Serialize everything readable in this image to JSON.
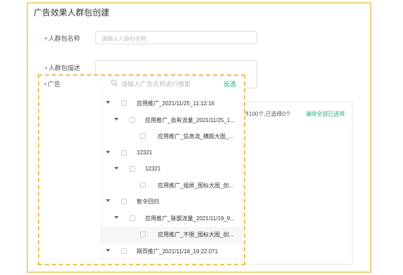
{
  "page": {
    "title": "广告效果人群包创建"
  },
  "form": {
    "name": {
      "label": "人群包名称",
      "placeholder": "请输入人群包名称"
    },
    "desc": {
      "label": "人群包描述"
    },
    "ad": {
      "label": "广告"
    }
  },
  "selected_panel": {
    "summary": "共100个,已选择0个",
    "clear_label": "清除全部已选项"
  },
  "dropdown": {
    "search_placeholder": "请输入广告名称进行搜索",
    "invert_label": "反选",
    "rows": [
      {
        "label": "应用推广_2021/11/25_11:12:16",
        "level": 0,
        "expandable": true
      },
      {
        "label": "应用推广_自有流量_2021/11/25_1...",
        "level": 1,
        "expandable": true
      },
      {
        "label": "应用推广_信息流_横版大图_...",
        "level": 2,
        "expandable": false
      },
      {
        "label": "12321",
        "level": 0,
        "expandable": true
      },
      {
        "label": "12321",
        "level": 1,
        "expandable": true
      },
      {
        "label": "应用推广_插屏_图标大图_创...",
        "level": 2,
        "expandable": false
      },
      {
        "label": "智令回归",
        "level": 0,
        "expandable": true
      },
      {
        "label": "应用推广_联盟流量_2021/11/19_9...",
        "level": 1,
        "expandable": true
      },
      {
        "label": "应用推广_不限_图标大图_创...",
        "level": 2,
        "expandable": false,
        "highlighted": true
      },
      {
        "label": "网页推广_2021/11/18_19:22:071",
        "level": 0,
        "expandable": true
      }
    ]
  },
  "colors": {
    "accent": "#1aad73",
    "highlight_border": "#f0c14b",
    "required": "#e5484d"
  }
}
